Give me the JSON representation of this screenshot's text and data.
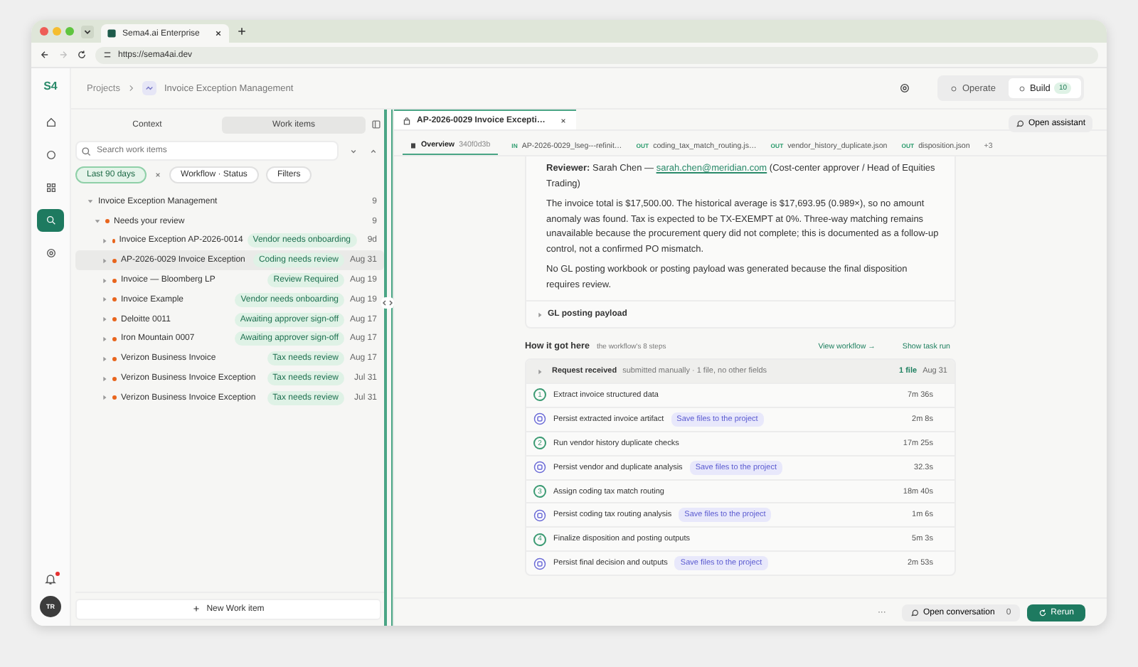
{
  "browser": {
    "tab_title": "Sema4.ai Enterprise",
    "url": "https://sema4ai.dev"
  },
  "rail": {
    "logo": "S4",
    "items": [
      {
        "kind": "home",
        "selected": false
      },
      {
        "kind": "circle",
        "selected": false
      },
      {
        "kind": "grid",
        "selected": false
      },
      {
        "kind": "search",
        "selected": true
      },
      {
        "kind": "gear",
        "selected": false
      }
    ],
    "notifications_unread": true,
    "avatar": "TR"
  },
  "header": {
    "breadcrumb": [
      "Projects",
      "Invoice Exception Management"
    ],
    "modes": [
      {
        "label": "Operate",
        "selected": false
      },
      {
        "label": "Build",
        "selected": true,
        "badge": "10"
      }
    ]
  },
  "work_panel": {
    "tabs": [
      {
        "label": "Context",
        "selected": false
      },
      {
        "label": "Work items",
        "selected": true
      }
    ],
    "search": {
      "placeholder": "Search work items"
    },
    "filters": [
      {
        "label": "Last 90 days",
        "selected": true
      },
      {
        "label": "Workflow · Status",
        "selected": false
      },
      {
        "label": "Filters",
        "selected": false
      }
    ],
    "tree": {
      "label": "Invoice Exception Management",
      "count": "9",
      "expanded": true,
      "children": [
        {
          "label": "Needs your review",
          "count": "9",
          "expanded": true,
          "children": [
            {
              "label": "Invoice Exception AP-2026-0014",
              "status": "Vendor needs onboarding",
              "date": "9d",
              "selected": false
            },
            {
              "label": "AP-2026-0029 Invoice Exception",
              "status": "Coding needs review",
              "date": "Aug 31",
              "selected": true
            },
            {
              "label": "Invoice — Bloomberg LP",
              "status": "Review Required",
              "date": "Aug 19",
              "selected": false
            },
            {
              "label": "Invoice Example",
              "status": "Vendor needs onboarding",
              "date": "Aug 19",
              "selected": false
            },
            {
              "label": "Deloitte 0011",
              "status": "Awaiting approver sign-off",
              "date": "Aug 17",
              "selected": false
            },
            {
              "label": "Iron Mountain 0007",
              "status": "Awaiting approver sign-off",
              "date": "Aug 17",
              "selected": false
            },
            {
              "label": "Verizon Business Invoice",
              "status": "Tax needs review",
              "date": "Aug 17",
              "selected": false
            },
            {
              "label": "Verizon Business Invoice Exception",
              "status": "Tax needs review",
              "date": "Jul 31",
              "selected": false
            },
            {
              "label": "Verizon Business Invoice Exception",
              "status": "Tax needs review",
              "date": "Jul 31",
              "selected": false
            }
          ]
        }
      ]
    },
    "new_button": "New Work item"
  },
  "detail": {
    "tab": "AP-2026-0029 Invoice Excepti…",
    "open_assistant": "Open assistant",
    "subtabs": [
      {
        "label": "Overview",
        "meta": "340f0d3b",
        "selected": true
      },
      {
        "prefix": "IN",
        "label": "AP-2026-0029_lseg---refinit…",
        "selected": false
      },
      {
        "prefix": "OUT",
        "label": "coding_tax_match_routing.js…",
        "selected": false
      },
      {
        "prefix": "OUT",
        "label": "vendor_history_duplicate.json",
        "selected": false
      },
      {
        "prefix": "OUT",
        "label": "disposition.json",
        "selected": false
      }
    ],
    "more": "+3",
    "reviewer": {
      "label": "Reviewer:",
      "name": "Sarah Chen —",
      "email": "sarah.chen@meridian.com",
      "role": "(Cost-center approver / Head of Equities Trading)"
    },
    "paragraphs": [
      "The invoice total is $17,500.00. The historical average is $17,693.95 (0.989×), so no amount anomaly was found. Tax is expected to be TX-EXEMPT at 0%. Three-way matching remains unavailable because the procurement query did not complete; this is documented as a follow-up control, not a confirmed PO mismatch.",
      "No GL posting workbook or posting payload was generated because the final disposition requires review."
    ],
    "section": {
      "label": "GL posting payload",
      "expanded": false
    },
    "history": {
      "title": "How it got here",
      "subtitle": "the workflow's 8 steps",
      "links": [
        "View workflow →",
        "Show task run"
      ],
      "request": {
        "title": "Request received",
        "detail": "submitted manually · 1 file, no other fields",
        "files": "1 file",
        "date": "Aug 31"
      },
      "steps": [
        {
          "kind": "step",
          "number": "1",
          "label": "Extract invoice structured data",
          "duration": "7m 36s"
        },
        {
          "kind": "action",
          "label": "Persist extracted invoice artifact",
          "tag": "Save files to the project",
          "duration": "2m 8s"
        },
        {
          "kind": "step",
          "number": "2",
          "label": "Run vendor history duplicate checks",
          "duration": "17m 25s"
        },
        {
          "kind": "action",
          "label": "Persist vendor and duplicate analysis",
          "tag": "Save files to the project",
          "duration": "32.3s"
        },
        {
          "kind": "step",
          "number": "3",
          "label": "Assign coding tax match routing",
          "duration": "18m 40s"
        },
        {
          "kind": "action",
          "label": "Persist coding tax routing analysis",
          "tag": "Save files to the project",
          "duration": "1m 6s"
        },
        {
          "kind": "step",
          "number": "4",
          "label": "Finalize disposition and posting outputs",
          "duration": "5m 3s"
        },
        {
          "kind": "action",
          "label": "Persist final decision and outputs",
          "tag": "Save files to the project",
          "duration": "2m 53s"
        }
      ]
    },
    "footer": {
      "more": "···",
      "conversation": {
        "label": "Open conversation",
        "count": "0"
      },
      "rerun": "Rerun"
    }
  }
}
